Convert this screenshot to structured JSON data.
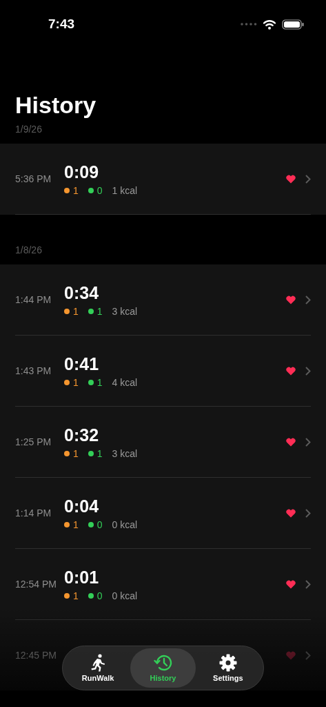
{
  "status_bar": {
    "time": "7:43"
  },
  "title": "History",
  "sections": [
    {
      "date": "1/9/26",
      "entries": [
        {
          "time": "5:36 PM",
          "duration": "0:09",
          "run": "1",
          "walk": "0",
          "kcal": "1 kcal"
        }
      ]
    },
    {
      "date": "1/8/26",
      "entries": [
        {
          "time": "1:44 PM",
          "duration": "0:34",
          "run": "1",
          "walk": "1",
          "kcal": "3 kcal"
        },
        {
          "time": "1:43 PM",
          "duration": "0:41",
          "run": "1",
          "walk": "1",
          "kcal": "4 kcal"
        },
        {
          "time": "1:25 PM",
          "duration": "0:32",
          "run": "1",
          "walk": "1",
          "kcal": "3 kcal"
        },
        {
          "time": "1:14 PM",
          "duration": "0:04",
          "run": "1",
          "walk": "0",
          "kcal": "0 kcal"
        },
        {
          "time": "12:54 PM",
          "duration": "0:01",
          "run": "1",
          "walk": "0",
          "kcal": "0 kcal"
        },
        {
          "time": "12:45 PM"
        }
      ]
    }
  ],
  "tab_bar": [
    {
      "kind": "run",
      "label": "RunWalk",
      "selected": false
    },
    {
      "kind": "history",
      "label": "History",
      "selected": true
    },
    {
      "kind": "settings",
      "label": "Settings",
      "selected": false
    }
  ]
}
